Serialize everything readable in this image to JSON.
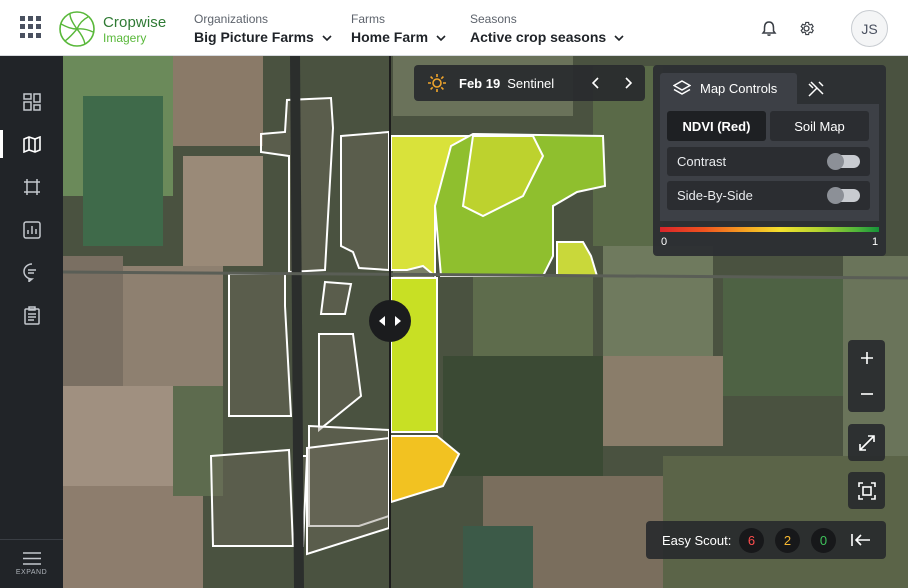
{
  "app": {
    "brand_line1": "Cropwise",
    "brand_line2": "Imagery"
  },
  "nav": {
    "organizations": {
      "label": "Organizations",
      "value": "Big Picture Farms"
    },
    "farms": {
      "label": "Farms",
      "value": "Home Farm"
    },
    "seasons": {
      "label": "Seasons",
      "value": "Active crop seasons"
    }
  },
  "user": {
    "initials": "JS"
  },
  "sidebar": {
    "items": [
      {
        "icon": "dashboard-icon"
      },
      {
        "icon": "map-icon",
        "active": true
      },
      {
        "icon": "field-boundary-icon"
      },
      {
        "icon": "report-chart-icon"
      },
      {
        "icon": "comment-icon"
      },
      {
        "icon": "clipboard-icon"
      }
    ],
    "expand_label": "EXPAND"
  },
  "imagery": {
    "date": "Feb 19",
    "source": "Sentinel"
  },
  "map_controls": {
    "tab_label": "Map Controls",
    "layers": {
      "active": "NDVI (Red)",
      "other": "Soil Map"
    },
    "contrast_label": "Contrast",
    "side_by_side_label": "Side-By-Side",
    "scale_min": "0",
    "scale_max": "1"
  },
  "easy_scout": {
    "label": "Easy Scout:",
    "counts": {
      "red": "6",
      "yellow": "2",
      "green": "0"
    },
    "colors": {
      "red": "#ff4d4d",
      "yellow": "#f5b731",
      "green": "#3fc25b"
    }
  },
  "colors": {
    "brand_green": "#2f7a34",
    "brand_light": "#59b83a",
    "rail_bg": "#212428"
  }
}
